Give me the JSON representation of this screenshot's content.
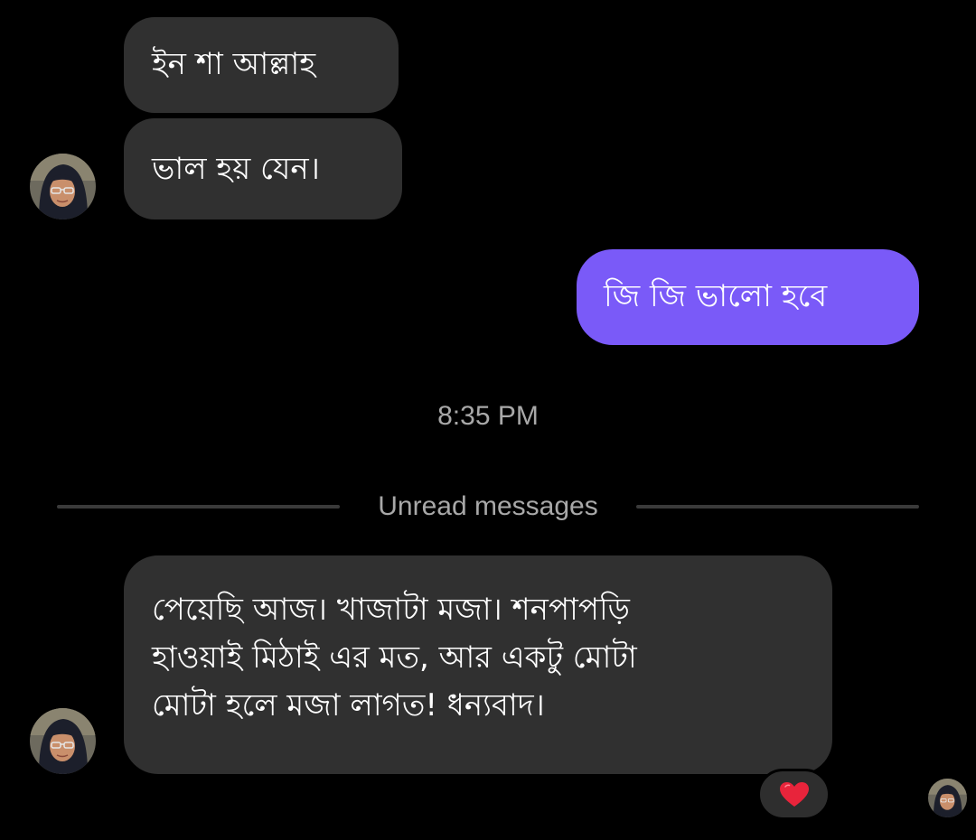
{
  "colors": {
    "background": "#000000",
    "incoming_bubble": "#303030",
    "outgoing_bubble": "#7a5af8",
    "meta_text": "#a8a8a8",
    "reaction_heart": "#e8243b"
  },
  "messages": [
    {
      "id": "b1",
      "direction": "incoming",
      "lines": [
        "ইন শা আল্লাহ"
      ]
    },
    {
      "id": "b2",
      "direction": "incoming",
      "lines": [
        "ভাল হয় যেন।"
      ]
    },
    {
      "id": "b3",
      "direction": "outgoing",
      "lines": [
        "জি জি ভালো হবে"
      ]
    },
    {
      "id": "b4",
      "direction": "incoming",
      "lines": [
        "পেয়েছি আজ। খাজাটা মজা। শনপাপড়ি",
        "হাওয়াই মিঠাই এর মত, আর একটু মোটা",
        "মোটা হলে মজা লাগত! ধন্যবাদ।"
      ],
      "reaction": "heart-icon"
    }
  ],
  "timestamp": "8:35 PM",
  "unread_divider": {
    "label": "Unread messages"
  },
  "avatars": {
    "sender_icon": "contact-avatar",
    "read_receipt_icon": "seen-avatar"
  }
}
